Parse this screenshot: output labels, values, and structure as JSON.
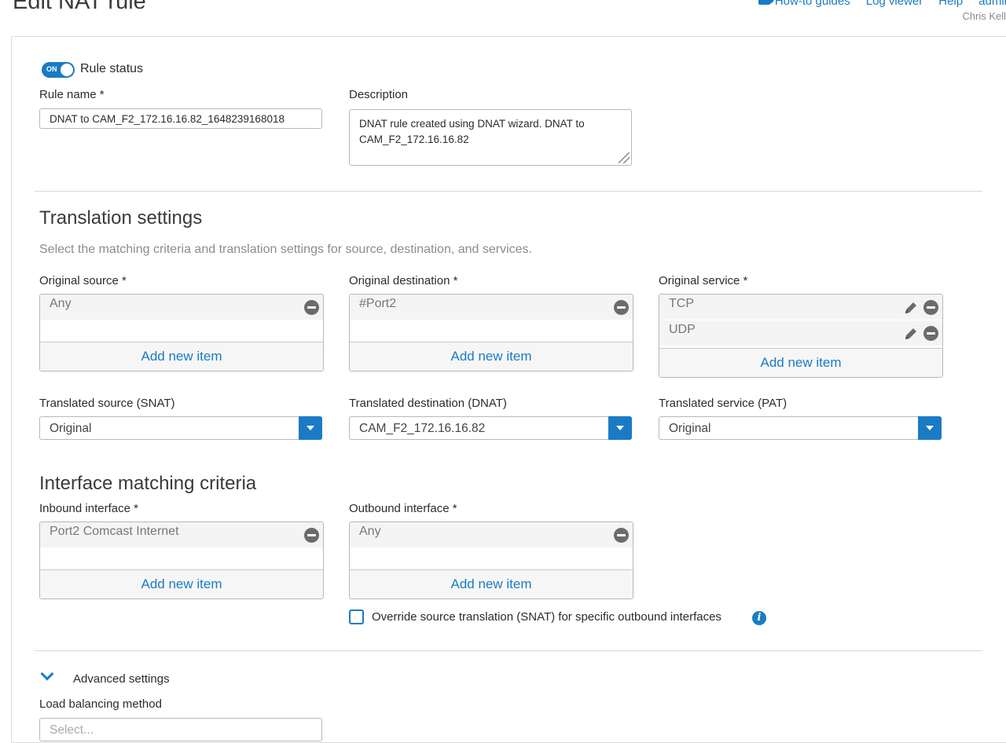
{
  "page": {
    "title": "Edit NAT rule",
    "links": {
      "how_to": "How-to guides",
      "log_viewer": "Log viewer",
      "help": "Help",
      "admin": "admin"
    },
    "user": "Chris Kell"
  },
  "rule": {
    "status_toggle": "ON",
    "status_label": "Rule status",
    "name_label": "Rule name *",
    "name_value": "DNAT to CAM_F2_172.16.16.82_1648239168018",
    "description_label": "Description",
    "description_value": "DNAT rule created using DNAT wizard. DNAT to CAM_F2_172.16.16.82"
  },
  "translation": {
    "title": "Translation settings",
    "description": "Select the matching criteria and translation settings for source, destination, and services.",
    "original_source": {
      "label": "Original source *",
      "items": [
        "Any"
      ],
      "add": "Add new item"
    },
    "original_destination": {
      "label": "Original destination *",
      "items": [
        "#Port2"
      ],
      "add": "Add new item"
    },
    "original_service": {
      "label": "Original service *",
      "items": [
        "TCP",
        "UDP"
      ],
      "add": "Add new item"
    },
    "translated_source": {
      "label": "Translated source (SNAT)",
      "value": "Original"
    },
    "translated_destination": {
      "label": "Translated destination (DNAT)",
      "value": "CAM_F2_172.16.16.82"
    },
    "translated_service": {
      "label": "Translated service (PAT)",
      "value": "Original"
    }
  },
  "interface": {
    "title": "Interface matching criteria",
    "inbound": {
      "label": "Inbound interface *",
      "items": [
        "Port2 Comcast Internet"
      ],
      "add": "Add new item"
    },
    "outbound": {
      "label": "Outbound interface *",
      "items": [
        "Any"
      ],
      "add": "Add new item"
    },
    "override_label": "Override source translation (SNAT) for specific outbound interfaces",
    "override_checked": false
  },
  "advanced": {
    "label": "Advanced settings",
    "load_balancing_label": "Load balancing method",
    "load_balancing_placeholder": "Select..."
  },
  "colors": {
    "accent": "#1a7bc4",
    "muted": "#8c8c8c",
    "border": "#b8b8b8"
  }
}
